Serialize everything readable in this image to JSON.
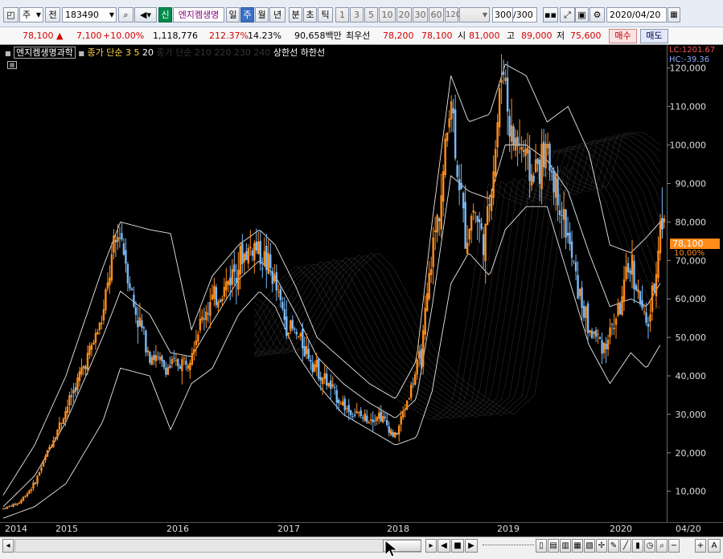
{
  "toolbar": {
    "type_label": "주",
    "jeon_label": "전",
    "code_value": "183490",
    "sin_label": "신",
    "stock_name": "엔지켐생명",
    "periods": [
      "일",
      "주",
      "월",
      "년"
    ],
    "active_period": "주",
    "intervals": [
      "분",
      "초",
      "틱"
    ],
    "counts": [
      "1",
      "3",
      "5",
      "10",
      "20",
      "30",
      "60",
      "120"
    ],
    "range": "300",
    "range_total": "/300",
    "date": "2020/04/20"
  },
  "quote": {
    "price": "78,100",
    "change": "7,100",
    "change_pct": "+10.00%",
    "volume": "1,118,776",
    "vol_ratio": "212.37%",
    "turnover": "14.23%",
    "amount": "90,658백만",
    "best_label": "최우선",
    "best_ask": "78,200",
    "best_bid": "78,100",
    "open_label": "시",
    "open": "81,000",
    "high_label": "고",
    "high": "89,000",
    "low_label": "저",
    "low": "75,600",
    "buy_label": "매수",
    "sell_label": "매도"
  },
  "legend": {
    "name": "엔지켐생명과학",
    "ma_label": "종가 단순",
    "ma1": "3",
    "ma2": "5",
    "ma3": "20",
    "ma_long": "종가 단순 210 220 230 240",
    "upper_limit": "상한선",
    "lower_limit": "하한선"
  },
  "right_info": {
    "lc": "LC:1201.67",
    "hc": "HC:-39.36",
    "current_price": "78,100",
    "current_pct": "10.00%"
  },
  "chart_data": {
    "type": "candlestick",
    "y_ticks": [
      "120,000",
      "110,000",
      "100,000",
      "90,000",
      "80,000",
      "70,000",
      "60,000",
      "50,000",
      "40,000",
      "30,000",
      "20,000",
      "10,000"
    ],
    "x_ticks": [
      "2014",
      "2015",
      "2016",
      "2017",
      "2018",
      "2019",
      "2020",
      "04/20"
    ],
    "ylim": [
      2000,
      126000
    ],
    "price_path": [
      [
        2014.0,
        5500
      ],
      [
        2014.15,
        7000
      ],
      [
        2014.3,
        12000
      ],
      [
        2014.45,
        22000
      ],
      [
        2014.55,
        28000
      ],
      [
        2014.7,
        38000
      ],
      [
        2014.85,
        48000
      ],
      [
        2014.95,
        55000
      ],
      [
        2015.05,
        72000
      ],
      [
        2015.12,
        78000
      ],
      [
        2015.25,
        58000
      ],
      [
        2015.4,
        46000
      ],
      [
        2015.55,
        42000
      ],
      [
        2015.75,
        44000
      ],
      [
        2015.95,
        58000
      ],
      [
        2016.1,
        62000
      ],
      [
        2016.25,
        70000
      ],
      [
        2016.4,
        74000
      ],
      [
        2016.55,
        68000
      ],
      [
        2016.7,
        54000
      ],
      [
        2016.85,
        49000
      ],
      [
        2017.0,
        42000
      ],
      [
        2017.15,
        36000
      ],
      [
        2017.3,
        31000
      ],
      [
        2017.45,
        29000
      ],
      [
        2017.6,
        30000
      ],
      [
        2017.75,
        24000
      ],
      [
        2017.9,
        37000
      ],
      [
        2018.0,
        46000
      ],
      [
        2018.1,
        72000
      ],
      [
        2018.2,
        90000
      ],
      [
        2018.28,
        115000
      ],
      [
        2018.32,
        100000
      ],
      [
        2018.42,
        76000
      ],
      [
        2018.5,
        84000
      ],
      [
        2018.6,
        74000
      ],
      [
        2018.7,
        98000
      ],
      [
        2018.78,
        123000
      ],
      [
        2018.85,
        102000
      ],
      [
        2018.95,
        100000
      ],
      [
        2019.05,
        92000
      ],
      [
        2019.2,
        98000
      ],
      [
        2019.35,
        82000
      ],
      [
        2019.5,
        62000
      ],
      [
        2019.6,
        52000
      ],
      [
        2019.75,
        48000
      ],
      [
        2019.9,
        58000
      ],
      [
        2020.0,
        70000
      ],
      [
        2020.08,
        60000
      ],
      [
        2020.15,
        52000
      ],
      [
        2020.22,
        62000
      ],
      [
        2020.28,
        80000
      ]
    ],
    "bollinger": {
      "upper": [
        [
          2014.0,
          9000
        ],
        [
          2014.3,
          22000
        ],
        [
          2014.6,
          40000
        ],
        [
          2014.95,
          68000
        ],
        [
          2015.12,
          80000
        ],
        [
          2015.4,
          78000
        ],
        [
          2015.6,
          77000
        ],
        [
          2015.8,
          52000
        ],
        [
          2016.0,
          66000
        ],
        [
          2016.25,
          74000
        ],
        [
          2016.45,
          78000
        ],
        [
          2016.6,
          74000
        ],
        [
          2016.8,
          63000
        ],
        [
          2017.0,
          50000
        ],
        [
          2017.25,
          44000
        ],
        [
          2017.5,
          38000
        ],
        [
          2017.75,
          34000
        ],
        [
          2017.95,
          44000
        ],
        [
          2018.1,
          80000
        ],
        [
          2018.28,
          118000
        ],
        [
          2018.45,
          106000
        ],
        [
          2018.65,
          108000
        ],
        [
          2018.8,
          121000
        ],
        [
          2019.0,
          118000
        ],
        [
          2019.2,
          106000
        ],
        [
          2019.4,
          110000
        ],
        [
          2019.6,
          98000
        ],
        [
          2019.8,
          74000
        ],
        [
          2020.0,
          72000
        ],
        [
          2020.15,
          76000
        ],
        [
          2020.28,
          80000
        ]
      ],
      "middle": [
        [
          2014.0,
          6000
        ],
        [
          2014.3,
          14000
        ],
        [
          2014.6,
          28000
        ],
        [
          2014.95,
          50000
        ],
        [
          2015.12,
          62000
        ],
        [
          2015.4,
          56000
        ],
        [
          2015.6,
          46000
        ],
        [
          2015.8,
          45000
        ],
        [
          2016.0,
          54000
        ],
        [
          2016.25,
          65000
        ],
        [
          2016.45,
          70000
        ],
        [
          2016.6,
          66000
        ],
        [
          2016.8,
          56000
        ],
        [
          2017.0,
          45000
        ],
        [
          2017.25,
          38000
        ],
        [
          2017.5,
          33000
        ],
        [
          2017.75,
          29000
        ],
        [
          2017.95,
          34000
        ],
        [
          2018.1,
          58000
        ],
        [
          2018.28,
          92000
        ],
        [
          2018.45,
          88000
        ],
        [
          2018.65,
          86000
        ],
        [
          2018.8,
          100000
        ],
        [
          2019.0,
          100000
        ],
        [
          2019.2,
          96000
        ],
        [
          2019.4,
          88000
        ],
        [
          2019.6,
          72000
        ],
        [
          2019.8,
          58000
        ],
        [
          2020.0,
          60000
        ],
        [
          2020.15,
          58000
        ],
        [
          2020.28,
          64000
        ]
      ],
      "lower": [
        [
          2014.0,
          3000
        ],
        [
          2014.3,
          6000
        ],
        [
          2014.6,
          12000
        ],
        [
          2014.95,
          28000
        ],
        [
          2015.12,
          42000
        ],
        [
          2015.4,
          40000
        ],
        [
          2015.6,
          26000
        ],
        [
          2015.8,
          38000
        ],
        [
          2016.0,
          42000
        ],
        [
          2016.25,
          56000
        ],
        [
          2016.45,
          62000
        ],
        [
          2016.6,
          58000
        ],
        [
          2016.8,
          46000
        ],
        [
          2017.0,
          38000
        ],
        [
          2017.25,
          30000
        ],
        [
          2017.5,
          26000
        ],
        [
          2017.75,
          22000
        ],
        [
          2017.95,
          24000
        ],
        [
          2018.1,
          36000
        ],
        [
          2018.28,
          64000
        ],
        [
          2018.45,
          72000
        ],
        [
          2018.65,
          66000
        ],
        [
          2018.8,
          78000
        ],
        [
          2019.0,
          84000
        ],
        [
          2019.2,
          84000
        ],
        [
          2019.4,
          66000
        ],
        [
          2019.6,
          48000
        ],
        [
          2019.8,
          38000
        ],
        [
          2020.0,
          46000
        ],
        [
          2020.15,
          42000
        ],
        [
          2020.28,
          48000
        ]
      ]
    }
  },
  "colors": {
    "bull": "#ff8c1a",
    "bear": "#7ab8f5",
    "band": "#e8e8e8",
    "ma_faint": "#555555",
    "price_tag": "#ff8c1a"
  }
}
